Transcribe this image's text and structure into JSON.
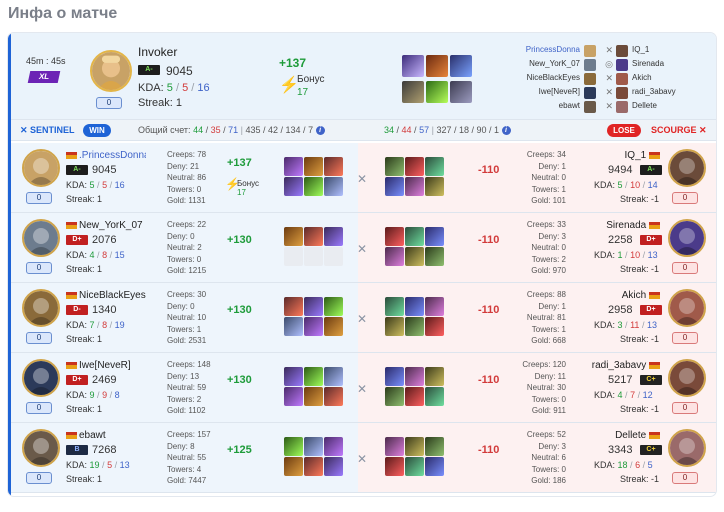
{
  "page_title": "Инфа о матче",
  "header": {
    "duration": "45m : 45s",
    "size": "XL",
    "hero_name": "Invoker",
    "rank": "A-",
    "mmr": "9045",
    "kda_label": "KDA:",
    "kills": "5",
    "deaths": "5",
    "assists": "16",
    "streak": "Streak: 1",
    "gain": "+137",
    "bonus_label": "Бонус",
    "bonus_value": "17",
    "zero_badge": "0",
    "team_left": [
      "PrincessDonna",
      "New_YorK_07",
      "NiceBlackEyes",
      "Iwe[NeveR]",
      "ebawt"
    ],
    "team_right": [
      "IQ_1",
      "Sirenada",
      "Akich",
      "radi_3abavy",
      "Dellete"
    ]
  },
  "bar": {
    "sentinel": "SENTINEL",
    "win": "WIN",
    "score_label": "Общий счет:",
    "s_kills": "44",
    "s_deaths": "35",
    "s_assists": "71",
    "s_other": "435 / 42 / 134 / 7",
    "r_kills": "34",
    "r_deaths": "44",
    "r_assists": "57",
    "r_other": "327 / 18 / 90 / 1",
    "lose": "LOSE",
    "scourge": "SCOURGE",
    "info": "i"
  },
  "players": [
    {
      "left": {
        "name": ".PrincessDonna",
        "rank": "A-",
        "mmr": "9045",
        "k": "5",
        "d": "5",
        "a": "16",
        "streak": "Streak: 1",
        "creeps": "Creeps: 78",
        "deny": "Deny: 21",
        "neutral": "Neutral: 86",
        "towers": "Towers: 0",
        "gold": "Gold: 1131",
        "gain": "+137",
        "bonus": "Бонус",
        "bonus_val": "17",
        "zero": "0"
      },
      "right": {
        "name": "IQ_1",
        "rank": "A-",
        "mmr": "9494",
        "k": "5",
        "d": "10",
        "a": "14",
        "streak": "Streak: -1",
        "creeps": "Creeps: 34",
        "deny": "Deny: 1",
        "neutral": "Neutral: 0",
        "towers": "Towers: 1",
        "gold": "Gold: 101",
        "gain": "-110",
        "zero": "0"
      }
    },
    {
      "left": {
        "name": "New_YorK_07",
        "rank": "D+",
        "mmr": "2076",
        "k": "4",
        "d": "8",
        "a": "15",
        "streak": "Streak: 1",
        "creeps": "Creeps: 22",
        "deny": "Deny: 0",
        "neutral": "Neutral: 2",
        "towers": "Towers: 0",
        "gold": "Gold: 1215",
        "gain": "+130",
        "zero": "0"
      },
      "right": {
        "name": "Sirenada",
        "rank": "D+",
        "mmr": "2258",
        "k": "1",
        "d": "10",
        "a": "13",
        "streak": "Streak: -1",
        "creeps": "Creeps: 33",
        "deny": "Deny: 3",
        "neutral": "Neutral: 0",
        "towers": "Towers: 2",
        "gold": "Gold: 970",
        "gain": "-110",
        "zero": "0"
      }
    },
    {
      "left": {
        "name": "NiceBlackEyes",
        "rank": "D-",
        "mmr": "1340",
        "k": "7",
        "d": "8",
        "a": "19",
        "streak": "Streak: 1",
        "creeps": "Creeps: 30",
        "deny": "Deny: 0",
        "neutral": "Neutral: 10",
        "towers": "Towers: 1",
        "gold": "Gold: 2531",
        "gain": "+130",
        "zero": "0"
      },
      "right": {
        "name": "Akich",
        "rank": "D+",
        "mmr": "2958",
        "k": "3",
        "d": "11",
        "a": "13",
        "streak": "Streak: -1",
        "creeps": "Creeps: 88",
        "deny": "Deny: 1",
        "neutral": "Neutral: 81",
        "towers": "Towers: 1",
        "gold": "Gold: 668",
        "gain": "-110",
        "zero": "0"
      }
    },
    {
      "left": {
        "name": "Iwe[NeveR]",
        "rank": "D+",
        "mmr": "2469",
        "k": "9",
        "d": "9",
        "a": "8",
        "streak": "Streak: 1",
        "creeps": "Creeps: 148",
        "deny": "Deny: 13",
        "neutral": "Neutral: 59",
        "towers": "Towers: 2",
        "gold": "Gold: 1102",
        "gain": "+130",
        "zero": "0"
      },
      "right": {
        "name": "radi_3abavy",
        "rank": "C+",
        "mmr": "5217",
        "k": "4",
        "d": "7",
        "a": "12",
        "streak": "Streak: -1",
        "creeps": "Creeps: 120",
        "deny": "Deny: 11",
        "neutral": "Neutral: 30",
        "towers": "Towers: 0",
        "gold": "Gold: 911",
        "gain": "-110",
        "zero": "0"
      }
    },
    {
      "left": {
        "name": "ebawt",
        "rank": "B",
        "mmr": "7268",
        "k": "19",
        "d": "5",
        "a": "13",
        "streak": "Streak: 1",
        "creeps": "Creeps: 157",
        "deny": "Deny: 8",
        "neutral": "Neutral: 55",
        "towers": "Towers: 4",
        "gold": "Gold: 7447",
        "gain": "+125",
        "zero": "0"
      },
      "right": {
        "name": "Dellete",
        "rank": "C+",
        "mmr": "3343",
        "k": "18",
        "d": "6",
        "a": "5",
        "streak": "Streak: -1",
        "creeps": "Creeps: 52",
        "deny": "Deny: 3",
        "neutral": "Neutral: 6",
        "towers": "Towers: 0",
        "gold": "Gold: 186",
        "gain": "-110",
        "zero": "0"
      }
    }
  ],
  "colors": {
    "sentinel_blue": "#1e63d6",
    "scourge_red": "#e02424",
    "gain_green": "#1e9b3a",
    "loss_red": "#d23b3b",
    "left_row_bg": "#eef5fc",
    "right_row_bg": "#fdf1f1"
  },
  "icons": {
    "bolt": "lightning-bolt-icon",
    "vs": "crossed-swords-icon",
    "info": "info-icon"
  }
}
